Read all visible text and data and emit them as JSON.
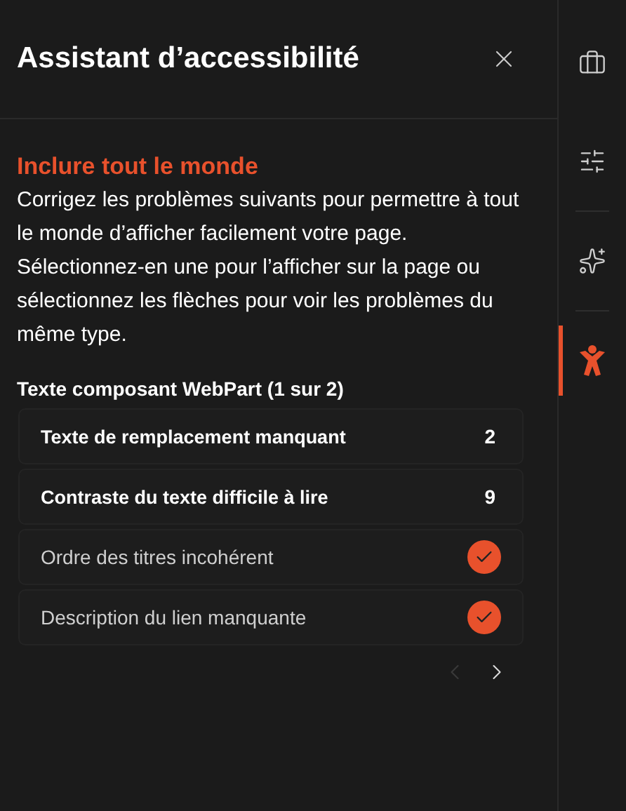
{
  "panel": {
    "title": "Assistant d’accessibilité"
  },
  "section": {
    "heading": "Inclure tout le monde",
    "description": "Corrigez les problèmes suivants pour permettre à tout le monde d’afficher facilement votre page. Sélectionnez-en une pour l’afficher sur la page ou sélectionnez les flèches pour voir les problèmes du même type."
  },
  "group": {
    "title": "Texte composant WebPart (1 sur 2)",
    "issues": [
      {
        "kind": "count",
        "label": "Texte de remplacement manquant",
        "count": "2"
      },
      {
        "kind": "count",
        "label": "Contraste du texte difficile à lire",
        "count": "9"
      },
      {
        "kind": "resolved",
        "label": "Ordre des titres incohérent"
      },
      {
        "kind": "resolved",
        "label": "Description du lien manquante"
      }
    ]
  },
  "pager": {
    "previous_disabled": true,
    "next_disabled": false
  },
  "rail": [
    {
      "kind": "briefcase",
      "selected": false
    },
    {
      "kind": "sliders",
      "selected": false
    },
    {
      "kind": "sparkle",
      "selected": false
    },
    {
      "kind": "person",
      "selected": true
    }
  ]
}
